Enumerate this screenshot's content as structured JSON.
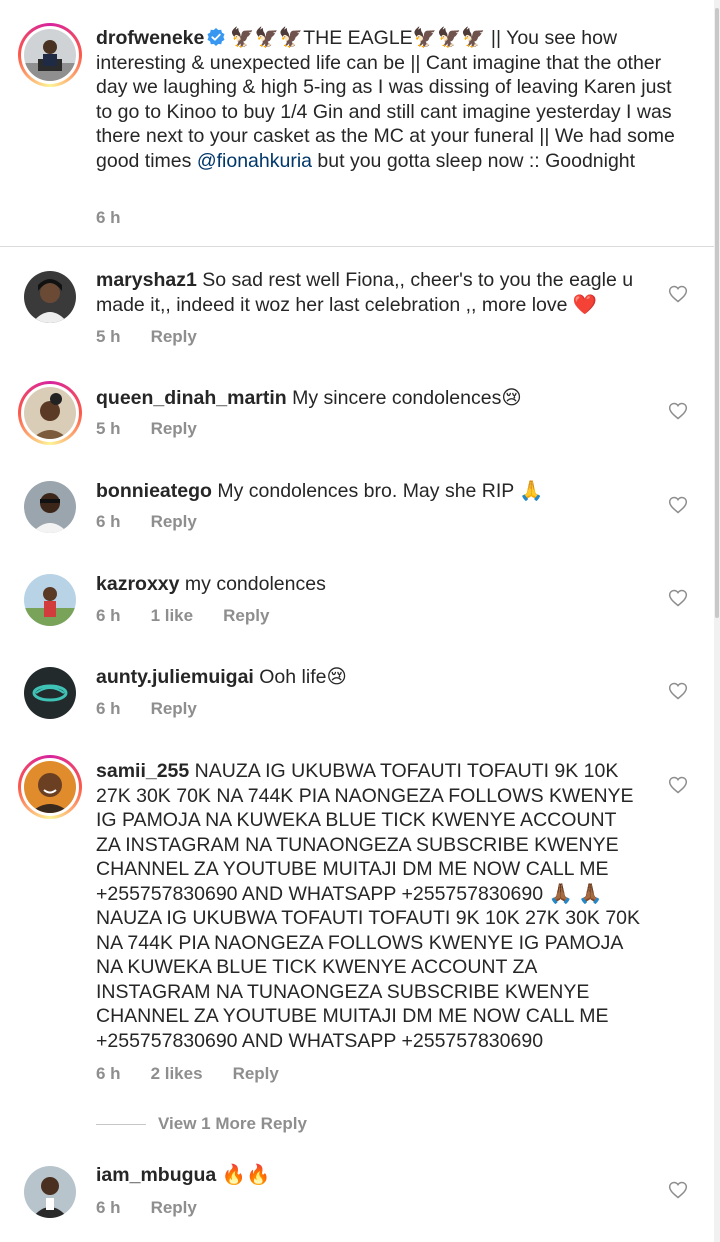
{
  "caption": {
    "username": "drofweneke",
    "verified": true,
    "text_before_mention": "🦅🦅🦅THE EAGLE🦅🦅🦅 || You see how interesting & unexpected life can be || Cant imagine that the other day we laughing & high 5-ing as I was dissing of leaving Karen just to go to Kinoo to buy 1/4 Gin and still cant imagine yesterday I was there next to your casket as the MC at your funeral || We had some good times ",
    "mention": "@fionahkuria",
    "text_after_mention": " but you gotta sleep now :: Goodnight",
    "time": "6 h"
  },
  "comments": [
    {
      "username": "maryshaz1",
      "text": "So sad rest well Fiona,, cheer's to you the eagle u made it,, indeed it woz her last celebration ,, more love ❤️",
      "time": "5 h",
      "likes": "",
      "reply_label": "Reply"
    },
    {
      "username": "queen_dinah_martin",
      "text": "My sincere condolences😢",
      "time": "5 h",
      "likes": "",
      "reply_label": "Reply"
    },
    {
      "username": "bonnieatego",
      "text": "My condolences bro. May she RIP 🙏",
      "time": "6 h",
      "likes": "",
      "reply_label": "Reply"
    },
    {
      "username": "kazroxxy",
      "text": "my condolences",
      "time": "6 h",
      "likes": "1 like",
      "reply_label": "Reply"
    },
    {
      "username": "aunty.juliemuigai",
      "text": "Ooh life😢",
      "time": "6 h",
      "likes": "",
      "reply_label": "Reply"
    },
    {
      "username": "samii_255",
      "text": "NAUZA IG UKUBWA TOFAUTI TOFAUTI  9K 10K 27K 30K 70K NA 744K PIA NAONGEZA FOLLOWS KWENYE IG PAMOJA NA KUWEKA BLUE TICK KWENYE ACCOUNT ZA INSTAGRAM NA TUNAONGEZA SUBSCRIBE KWENYE CHANNEL ZA YOUTUBE MUITAJI DM ME NOW CALL ME +255757830690 AND WHATSAPP +255757830690 🙏🏾 🙏🏾 NAUZA IG UKUBWA TOFAUTI TOFAUTI  9K 10K 27K 30K 70K NA 744K PIA NAONGEZA FOLLOWS KWENYE IG PAMOJA NA KUWEKA BLUE TICK KWENYE ACCOUNT ZA INSTAGRAM NA TUNAONGEZA SUBSCRIBE KWENYE CHANNEL ZA YOUTUBE MUITAJI DM ME NOW CALL ME +255757830690 AND WHATSAPP +255757830690",
      "time": "6 h",
      "likes": "2 likes",
      "reply_label": "Reply"
    },
    {
      "username": "iam_mbugua",
      "text": "🔥🔥",
      "time": "6 h",
      "likes": "",
      "reply_label": "Reply"
    }
  ],
  "view_more_replies": "View 1 More Reply",
  "icons": {
    "like": "heart-outline-icon",
    "verified": "verified-badge-icon"
  },
  "colors": {
    "text": "#262626",
    "secondary": "#8e8e8e",
    "mention": "#00376b",
    "verified": "#3897f0",
    "heart": "#ed4956"
  }
}
